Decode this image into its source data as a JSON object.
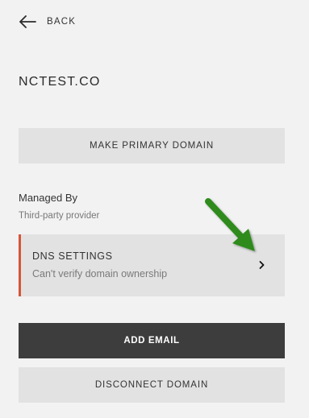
{
  "nav": {
    "back_label": "BACK"
  },
  "domain": {
    "name": "NCTEST.CO"
  },
  "actions": {
    "make_primary_label": "MAKE PRIMARY DOMAIN",
    "add_email_label": "ADD EMAIL",
    "disconnect_label": "DISCONNECT DOMAIN"
  },
  "managed_by": {
    "label": "Managed By",
    "value": "Third-party provider"
  },
  "dns_settings": {
    "title": "DNS SETTINGS",
    "status": "Can't verify domain ownership",
    "status_color": "#d9533a"
  },
  "icons": {
    "back": "arrow-left-icon",
    "chevron": "chevron-right-icon",
    "annotation": "green-pointer-arrow"
  },
  "colors": {
    "background": "#f2f2f2",
    "button_light": "#e2e2e2",
    "button_dark": "#3d3d3d",
    "annotation_arrow": "#2e8b1f"
  }
}
